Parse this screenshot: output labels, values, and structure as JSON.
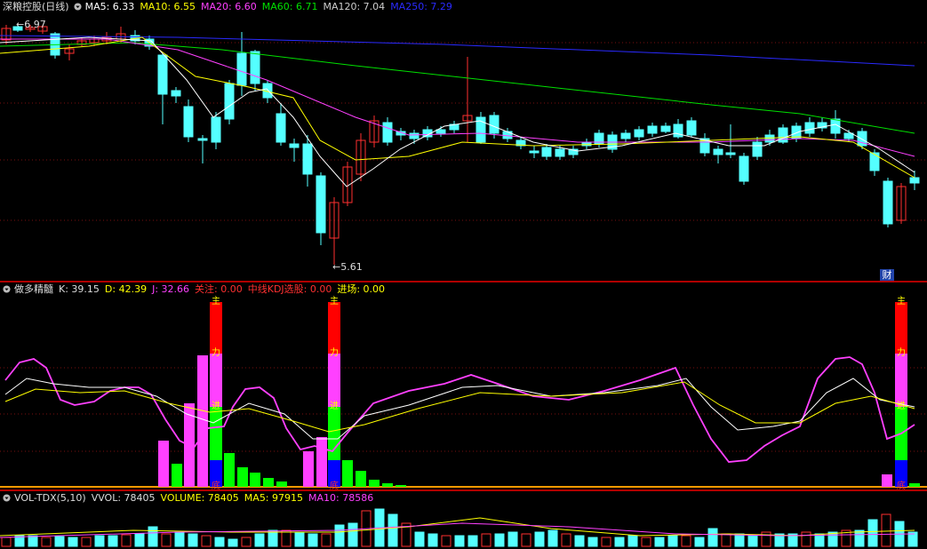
{
  "main": {
    "title": "深粮控股(日线)",
    "ma": [
      {
        "label": "MA5: 6.33",
        "color": "#ffffff"
      },
      {
        "label": "MA10: 6.55",
        "color": "#ffff00"
      },
      {
        "label": "MA20: 6.60",
        "color": "#ff40ff"
      },
      {
        "label": "MA60: 6.71",
        "color": "#00e000"
      },
      {
        "label": "MA120: 7.04",
        "color": "#cccccc"
      },
      {
        "label": "MA250: 7.29",
        "color": "#2a2aff"
      }
    ],
    "high_label": "6.97",
    "low_label": "5.61",
    "fin_badge": "财"
  },
  "kdj": {
    "title": "做多精髓",
    "items": [
      {
        "label": "K: 39.15",
        "color": "#dddddd"
      },
      {
        "label": "D: 42.39",
        "color": "#ffff00"
      },
      {
        "label": "J: 32.66",
        "color": "#ff40ff"
      },
      {
        "label": "关注: 0.00",
        "color": "#ff3030"
      },
      {
        "label": "中线KDJ选股: 0.00",
        "color": "#ff3030"
      },
      {
        "label": "进场: 0.00",
        "color": "#ffff00"
      }
    ],
    "markers": {
      "top": "主",
      "mid": "力",
      "low": "进",
      "bot": "底"
    }
  },
  "vol": {
    "title": "VOL-TDX(5,10)",
    "items": [
      {
        "label": "VVOL: 78405",
        "color": "#dddddd"
      },
      {
        "label": "VOLUME: 78405",
        "color": "#ffff00"
      },
      {
        "label": "MA5: 97915",
        "color": "#ffff00"
      },
      {
        "label": "MA10: 78586",
        "color": "#ff40ff"
      }
    ]
  }
}
